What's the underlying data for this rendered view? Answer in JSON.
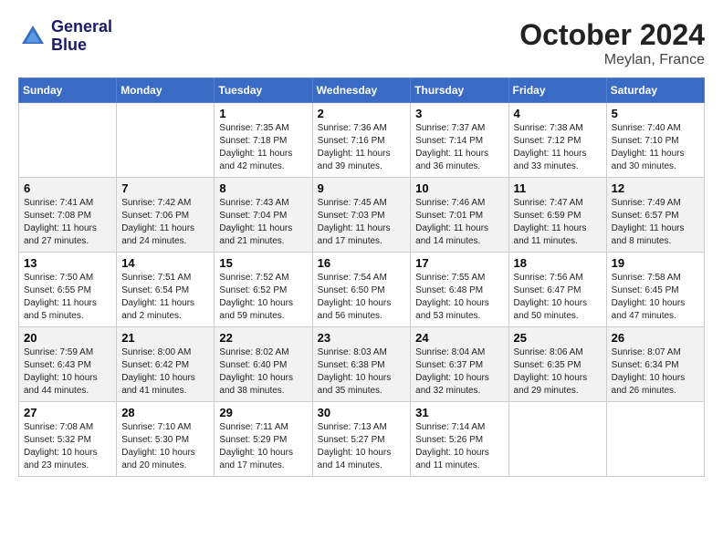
{
  "header": {
    "logo_line1": "General",
    "logo_line2": "Blue",
    "month": "October 2024",
    "location": "Meylan, France"
  },
  "weekdays": [
    "Sunday",
    "Monday",
    "Tuesday",
    "Wednesday",
    "Thursday",
    "Friday",
    "Saturday"
  ],
  "weeks": [
    [
      {
        "day": "",
        "info": ""
      },
      {
        "day": "",
        "info": ""
      },
      {
        "day": "1",
        "info": "Sunrise: 7:35 AM\nSunset: 7:18 PM\nDaylight: 11 hours and 42 minutes."
      },
      {
        "day": "2",
        "info": "Sunrise: 7:36 AM\nSunset: 7:16 PM\nDaylight: 11 hours and 39 minutes."
      },
      {
        "day": "3",
        "info": "Sunrise: 7:37 AM\nSunset: 7:14 PM\nDaylight: 11 hours and 36 minutes."
      },
      {
        "day": "4",
        "info": "Sunrise: 7:38 AM\nSunset: 7:12 PM\nDaylight: 11 hours and 33 minutes."
      },
      {
        "day": "5",
        "info": "Sunrise: 7:40 AM\nSunset: 7:10 PM\nDaylight: 11 hours and 30 minutes."
      }
    ],
    [
      {
        "day": "6",
        "info": "Sunrise: 7:41 AM\nSunset: 7:08 PM\nDaylight: 11 hours and 27 minutes."
      },
      {
        "day": "7",
        "info": "Sunrise: 7:42 AM\nSunset: 7:06 PM\nDaylight: 11 hours and 24 minutes."
      },
      {
        "day": "8",
        "info": "Sunrise: 7:43 AM\nSunset: 7:04 PM\nDaylight: 11 hours and 21 minutes."
      },
      {
        "day": "9",
        "info": "Sunrise: 7:45 AM\nSunset: 7:03 PM\nDaylight: 11 hours and 17 minutes."
      },
      {
        "day": "10",
        "info": "Sunrise: 7:46 AM\nSunset: 7:01 PM\nDaylight: 11 hours and 14 minutes."
      },
      {
        "day": "11",
        "info": "Sunrise: 7:47 AM\nSunset: 6:59 PM\nDaylight: 11 hours and 11 minutes."
      },
      {
        "day": "12",
        "info": "Sunrise: 7:49 AM\nSunset: 6:57 PM\nDaylight: 11 hours and 8 minutes."
      }
    ],
    [
      {
        "day": "13",
        "info": "Sunrise: 7:50 AM\nSunset: 6:55 PM\nDaylight: 11 hours and 5 minutes."
      },
      {
        "day": "14",
        "info": "Sunrise: 7:51 AM\nSunset: 6:54 PM\nDaylight: 11 hours and 2 minutes."
      },
      {
        "day": "15",
        "info": "Sunrise: 7:52 AM\nSunset: 6:52 PM\nDaylight: 10 hours and 59 minutes."
      },
      {
        "day": "16",
        "info": "Sunrise: 7:54 AM\nSunset: 6:50 PM\nDaylight: 10 hours and 56 minutes."
      },
      {
        "day": "17",
        "info": "Sunrise: 7:55 AM\nSunset: 6:48 PM\nDaylight: 10 hours and 53 minutes."
      },
      {
        "day": "18",
        "info": "Sunrise: 7:56 AM\nSunset: 6:47 PM\nDaylight: 10 hours and 50 minutes."
      },
      {
        "day": "19",
        "info": "Sunrise: 7:58 AM\nSunset: 6:45 PM\nDaylight: 10 hours and 47 minutes."
      }
    ],
    [
      {
        "day": "20",
        "info": "Sunrise: 7:59 AM\nSunset: 6:43 PM\nDaylight: 10 hours and 44 minutes."
      },
      {
        "day": "21",
        "info": "Sunrise: 8:00 AM\nSunset: 6:42 PM\nDaylight: 10 hours and 41 minutes."
      },
      {
        "day": "22",
        "info": "Sunrise: 8:02 AM\nSunset: 6:40 PM\nDaylight: 10 hours and 38 minutes."
      },
      {
        "day": "23",
        "info": "Sunrise: 8:03 AM\nSunset: 6:38 PM\nDaylight: 10 hours and 35 minutes."
      },
      {
        "day": "24",
        "info": "Sunrise: 8:04 AM\nSunset: 6:37 PM\nDaylight: 10 hours and 32 minutes."
      },
      {
        "day": "25",
        "info": "Sunrise: 8:06 AM\nSunset: 6:35 PM\nDaylight: 10 hours and 29 minutes."
      },
      {
        "day": "26",
        "info": "Sunrise: 8:07 AM\nSunset: 6:34 PM\nDaylight: 10 hours and 26 minutes."
      }
    ],
    [
      {
        "day": "27",
        "info": "Sunrise: 7:08 AM\nSunset: 5:32 PM\nDaylight: 10 hours and 23 minutes."
      },
      {
        "day": "28",
        "info": "Sunrise: 7:10 AM\nSunset: 5:30 PM\nDaylight: 10 hours and 20 minutes."
      },
      {
        "day": "29",
        "info": "Sunrise: 7:11 AM\nSunset: 5:29 PM\nDaylight: 10 hours and 17 minutes."
      },
      {
        "day": "30",
        "info": "Sunrise: 7:13 AM\nSunset: 5:27 PM\nDaylight: 10 hours and 14 minutes."
      },
      {
        "day": "31",
        "info": "Sunrise: 7:14 AM\nSunset: 5:26 PM\nDaylight: 10 hours and 11 minutes."
      },
      {
        "day": "",
        "info": ""
      },
      {
        "day": "",
        "info": ""
      }
    ]
  ]
}
